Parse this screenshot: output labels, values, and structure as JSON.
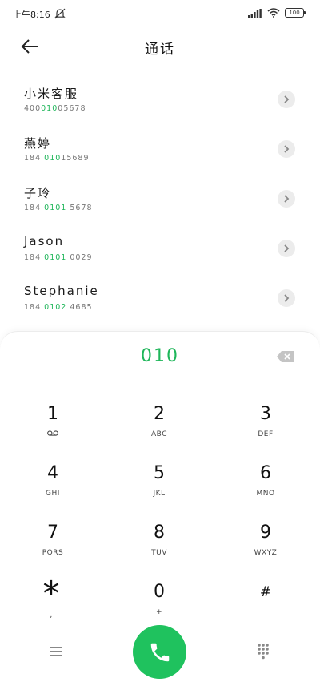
{
  "status_bar": {
    "time": "上午8:16",
    "battery": "100"
  },
  "header": {
    "title": "通话"
  },
  "contacts": [
    {
      "name": "小米客服",
      "number_pre": "400",
      "number_hl": "010",
      "number_post": "05678"
    },
    {
      "name": "燕婷",
      "number_pre": "184 ",
      "number_hl": "010",
      "number_post": "15689"
    },
    {
      "name": "子玲",
      "number_pre": "184 ",
      "number_hl": "0101",
      "number_post": " 5678"
    },
    {
      "name": "Jason",
      "number_pre": "184 ",
      "number_hl": "0101",
      "number_post": " 0029"
    },
    {
      "name": "Stephanie",
      "number_pre": "184 ",
      "number_hl": "0102",
      "number_post": " 4685"
    }
  ],
  "dialpad": {
    "input": "010",
    "keys": [
      {
        "num": "1",
        "letters": ""
      },
      {
        "num": "2",
        "letters": "ABC"
      },
      {
        "num": "3",
        "letters": "DEF"
      },
      {
        "num": "4",
        "letters": "GHI"
      },
      {
        "num": "5",
        "letters": "JKL"
      },
      {
        "num": "6",
        "letters": "MNO"
      },
      {
        "num": "7",
        "letters": "PQRS"
      },
      {
        "num": "8",
        "letters": "TUV"
      },
      {
        "num": "9",
        "letters": "WXYZ"
      },
      {
        "num": "*",
        "letters": ","
      },
      {
        "num": "0",
        "letters": "+"
      },
      {
        "num": "#",
        "letters": ""
      }
    ]
  },
  "colors": {
    "accent": "#1fb65a",
    "call_button": "#1fc25e"
  },
  "icons": {
    "back": "arrow-left-icon",
    "mute": "bell-off-icon",
    "signal": "signal-icon",
    "wifi": "wifi-icon",
    "battery": "battery-icon",
    "chevron": "chevron-right-icon",
    "backspace": "backspace-icon",
    "voicemail": "voicemail-icon",
    "menu": "menu-icon",
    "call": "phone-icon",
    "keypad": "keypad-icon"
  }
}
